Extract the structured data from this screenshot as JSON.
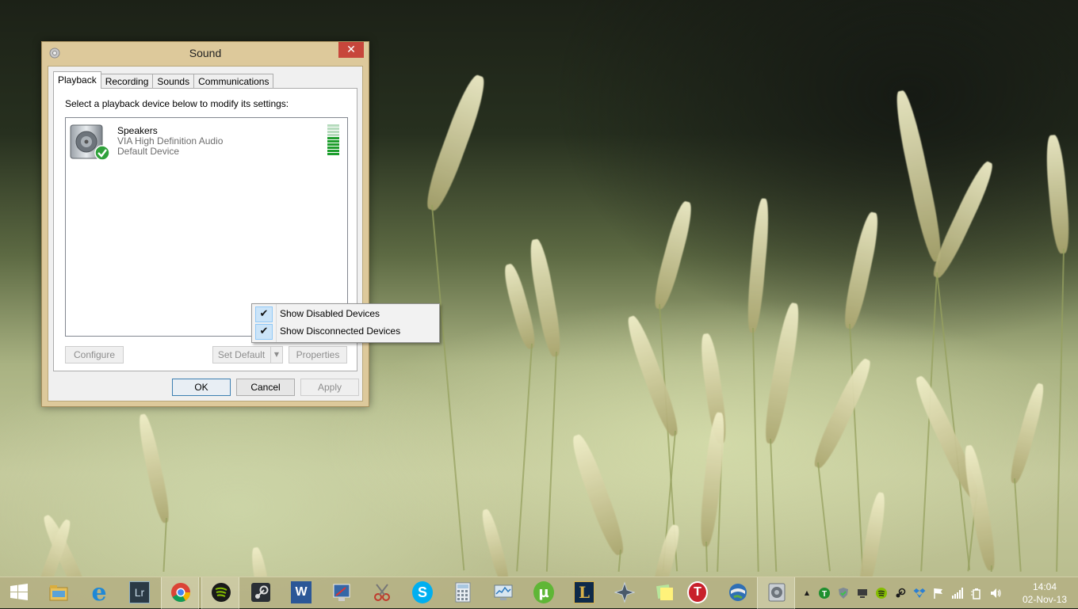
{
  "window": {
    "title": "Sound",
    "close_glyph": "✕",
    "tabs": [
      {
        "label": "Playback",
        "active": true
      },
      {
        "label": "Recording",
        "active": false
      },
      {
        "label": "Sounds",
        "active": false
      },
      {
        "label": "Communications",
        "active": false
      }
    ],
    "instruction": "Select a playback device below to modify its settings:",
    "device": {
      "name": "Speakers",
      "driver": "VIA High Definition Audio",
      "status": "Default Device",
      "icon": "speaker-icon",
      "default_badge": "green-checkmark-icon"
    },
    "level_meter": {
      "total_bars": 10,
      "lit_bars": 6,
      "lit_color": "#1e9e2e",
      "unlit_color": "#b6dbbd"
    },
    "buttons": {
      "configure": "Configure",
      "set_default": "Set Default",
      "properties": "Properties",
      "ok": "OK",
      "cancel": "Cancel",
      "apply": "Apply"
    }
  },
  "context_menu": {
    "items": [
      {
        "label": "Show Disabled Devices",
        "checked": true
      },
      {
        "label": "Show Disconnected Devices",
        "checked": true
      }
    ],
    "check_glyph": "✔"
  },
  "taskbar": {
    "apps": [
      {
        "name": "start-button",
        "icon": "windows-logo-icon"
      },
      {
        "name": "file-explorer",
        "icon": "folder-icon"
      },
      {
        "name": "internet-explorer",
        "icon": "ie-icon",
        "glyph": "e"
      },
      {
        "name": "lightroom",
        "icon": "lightroom-icon",
        "glyph": "Lr"
      },
      {
        "name": "chrome",
        "icon": "chrome-icon"
      },
      {
        "name": "spotify",
        "icon": "spotify-icon"
      },
      {
        "name": "steam",
        "icon": "steam-icon"
      },
      {
        "name": "word",
        "icon": "word-icon",
        "glyph": "W"
      },
      {
        "name": "remote-desktop",
        "icon": "remote-desktop-icon"
      },
      {
        "name": "snipping-tool",
        "icon": "scissors-icon"
      },
      {
        "name": "skype",
        "icon": "skype-icon",
        "glyph": "S"
      },
      {
        "name": "calculator",
        "icon": "calculator-icon"
      },
      {
        "name": "resource-monitor",
        "icon": "monitor-icon"
      },
      {
        "name": "utorrent",
        "icon": "utorrent-icon",
        "glyph": "µ"
      },
      {
        "name": "league-of-legends",
        "icon": "league-icon",
        "glyph": "L"
      },
      {
        "name": "starcraft",
        "icon": "starcraft-icon"
      },
      {
        "name": "sticky-notes",
        "icon": "sticky-notes-icon"
      },
      {
        "name": "tunnelbear",
        "icon": "stop-sign-icon",
        "glyph": "T"
      },
      {
        "name": "google-earth",
        "icon": "google-earth-icon"
      },
      {
        "name": "sound",
        "icon": "speaker-icon"
      }
    ],
    "tray": {
      "show_hidden_glyph": "▲",
      "icons": [
        "green-t-icon",
        "shield-check-icon",
        "device-icon",
        "spotify-icon",
        "steam-icon",
        "dropbox-icon",
        "flag-icon",
        "network-signal-icon",
        "power-icon",
        "volume-icon"
      ]
    },
    "clock": {
      "time": "14:04",
      "date": "02-Nov-13"
    }
  }
}
